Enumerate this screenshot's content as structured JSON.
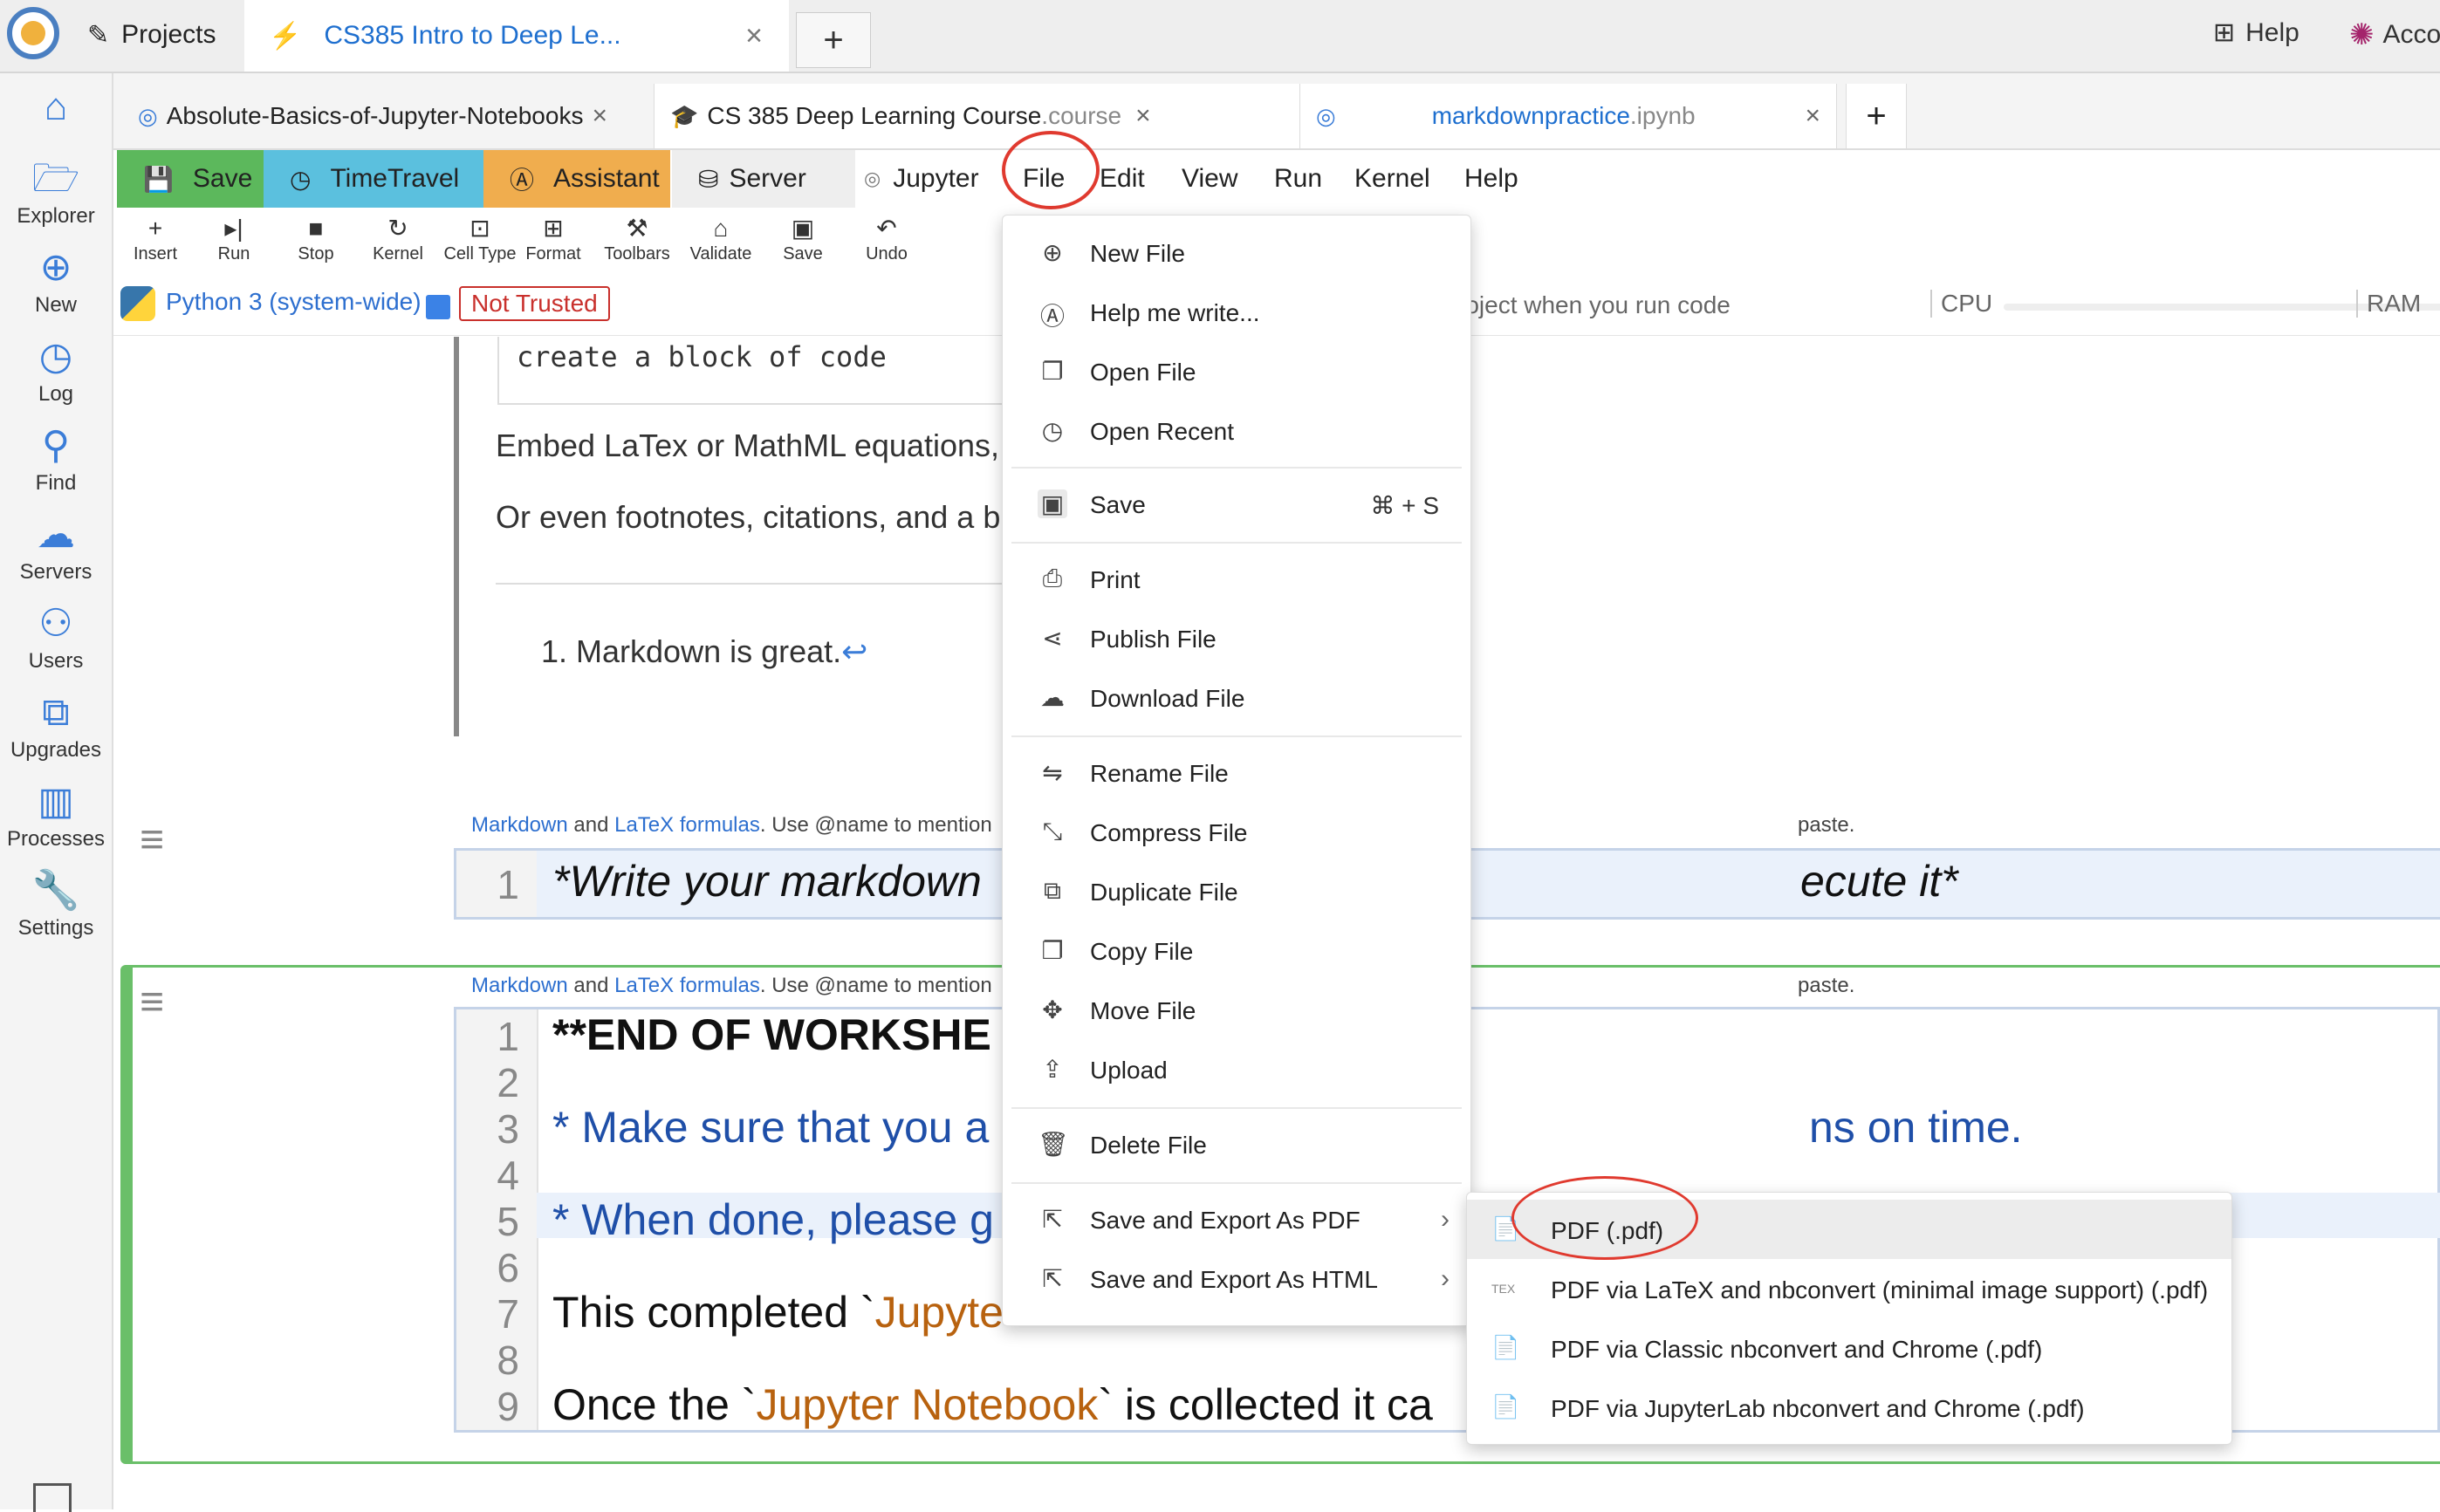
{
  "app": {
    "top_tabs": {
      "projects": "Projects",
      "course": "CS385 Intro to Deep Le...",
      "new": "+"
    },
    "help": "Help",
    "account": "Acco"
  },
  "sidebar": {
    "items": [
      {
        "label": "",
        "icon": "home-icon"
      },
      {
        "label": "Explorer",
        "icon": "folder-icon"
      },
      {
        "label": "New",
        "icon": "plus-circle-icon"
      },
      {
        "label": "Log",
        "icon": "clock-icon"
      },
      {
        "label": "Find",
        "icon": "search-icon"
      },
      {
        "label": "Servers",
        "icon": "server-icon"
      },
      {
        "label": "Users",
        "icon": "users-icon"
      },
      {
        "label": "Upgrades",
        "icon": "sliders-icon"
      },
      {
        "label": "Processes",
        "icon": "chip-icon"
      },
      {
        "label": "Settings",
        "icon": "wrench-icon"
      }
    ]
  },
  "file_tabs": [
    {
      "name": "Absolute-Basics-of-Jupyter-Notebooks",
      "ext": "",
      "close": "×"
    },
    {
      "name": "CS 385 Deep Learning Course",
      "ext": ".course",
      "close": "×"
    },
    {
      "name": "markdownpractice",
      "ext": ".ipynb",
      "close": "×"
    },
    {
      "name": "+",
      "ext": "",
      "close": ""
    }
  ],
  "action_bar": {
    "save": "Save",
    "timetravel": "TimeTravel",
    "assistant": "Assistant",
    "server": "Server",
    "menus": [
      "Jupyter",
      "File",
      "Edit",
      "View",
      "Run",
      "Kernel",
      "Help"
    ]
  },
  "toolbar": [
    "Insert",
    "Run",
    "Stop",
    "Kernel",
    "Cell Type",
    "Format",
    "Toolbars",
    "Validate",
    "Save",
    "Undo"
  ],
  "kernel": {
    "name": "Python 3 (system-wide)",
    "trust": "Not Trusted",
    "project_msg": "roject when you run code",
    "cpu": "CPU",
    "ram": "RAM"
  },
  "notebook": {
    "code_snippet": "create a block of code",
    "latex_line": "Embed LaTex or MathML equations,",
    "footnote_line": "Or even footnotes, citations, and a b",
    "list_item": "1.  Markdown is great.",
    "list_return": "↩",
    "cell_hint": {
      "link1": "Markdown",
      "and": " and ",
      "link2": "LaTeX formulas",
      "rest": ". Use @name to mention",
      "right": "paste."
    },
    "cell_b": {
      "lines": [
        "1"
      ],
      "code": [
        "*Write your markdown",
        "ecute it*"
      ]
    },
    "cell_c": {
      "lines": [
        "1",
        "2",
        "3",
        "4",
        "5",
        "6",
        "7",
        "8",
        "9"
      ],
      "l1": "**END OF WORKSHE",
      "l3a": "* Make sure that you a",
      "l3b": "ns on time.",
      "l5": "* When done, please g",
      "l7a": "This completed `",
      "l7b": "Jupyte",
      "l9a": "Once the `",
      "l9b": "Jupyter Notebook",
      "l9c": "` is collected it ca"
    }
  },
  "file_menu": {
    "items": [
      {
        "label": "New File",
        "icon": "plus-circle-icon"
      },
      {
        "label": "Help me write...",
        "icon": "ai-icon"
      },
      {
        "label": "Open File",
        "icon": "copy-icon"
      },
      {
        "label": "Open Recent",
        "icon": "history-icon"
      },
      {
        "label": "Save",
        "icon": "save-icon",
        "shortcut": "⌘ + S"
      },
      {
        "label": "Print",
        "icon": "printer-icon"
      },
      {
        "label": "Publish File",
        "icon": "share-icon"
      },
      {
        "label": "Download File",
        "icon": "cloud-download-icon"
      },
      {
        "label": "Rename File",
        "icon": "swap-icon"
      },
      {
        "label": "Compress File",
        "icon": "compress-icon"
      },
      {
        "label": "Duplicate File",
        "icon": "duplicate-icon"
      },
      {
        "label": "Copy File",
        "icon": "copy-icon"
      },
      {
        "label": "Move File",
        "icon": "move-icon"
      },
      {
        "label": "Upload",
        "icon": "upload-icon"
      },
      {
        "label": "Delete File",
        "icon": "trash-icon"
      },
      {
        "label": "Save and Export As PDF",
        "icon": "export-icon",
        "arrow": "›"
      },
      {
        "label": "Save and Export As HTML",
        "icon": "export-icon",
        "arrow": "›"
      }
    ]
  },
  "export_submenu": {
    "items": [
      {
        "label": "PDF (.pdf)",
        "icon": "pdf-icon"
      },
      {
        "label": "PDF via LaTeX and nbconvert (minimal image support) (.pdf)",
        "icon": "tex-icon",
        "icon_text": "TEX"
      },
      {
        "label": "PDF via Classic nbconvert and Chrome (.pdf)",
        "icon": "pdf-icon"
      },
      {
        "label": "PDF via JupyterLab nbconvert and Chrome (.pdf)",
        "icon": "pdf-icon"
      }
    ]
  },
  "colors": {
    "accent": "#2d6fcf",
    "save_green": "#5cb85c",
    "timetravel_blue": "#5bc0de",
    "assistant_orange": "#f0ad4e",
    "annotation_red": "#e03a2f",
    "code_string": "#b8620f",
    "md_blue": "#1f4fa8"
  }
}
